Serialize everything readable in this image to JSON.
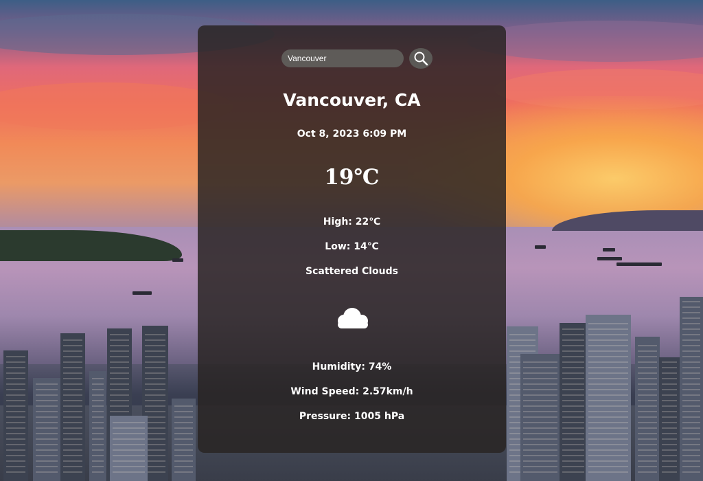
{
  "search": {
    "value": "Vancouver",
    "icon": "search-icon"
  },
  "weather": {
    "city": "Vancouver, CA",
    "datetime": "Oct 8, 2023 6:09 PM",
    "temperature": "19℃",
    "high": "High: 22℃",
    "low": "Low: 14℃",
    "description": "Scattered Clouds",
    "icon": "cloud-icon",
    "humidity": "Humidity: 74%",
    "wind_speed": "Wind Speed: 2.57km/h",
    "pressure": "Pressure: 1005 hPa"
  },
  "colors": {
    "card_background": "#282422",
    "input_background": "#5e5b58",
    "text": "#ffffff"
  }
}
